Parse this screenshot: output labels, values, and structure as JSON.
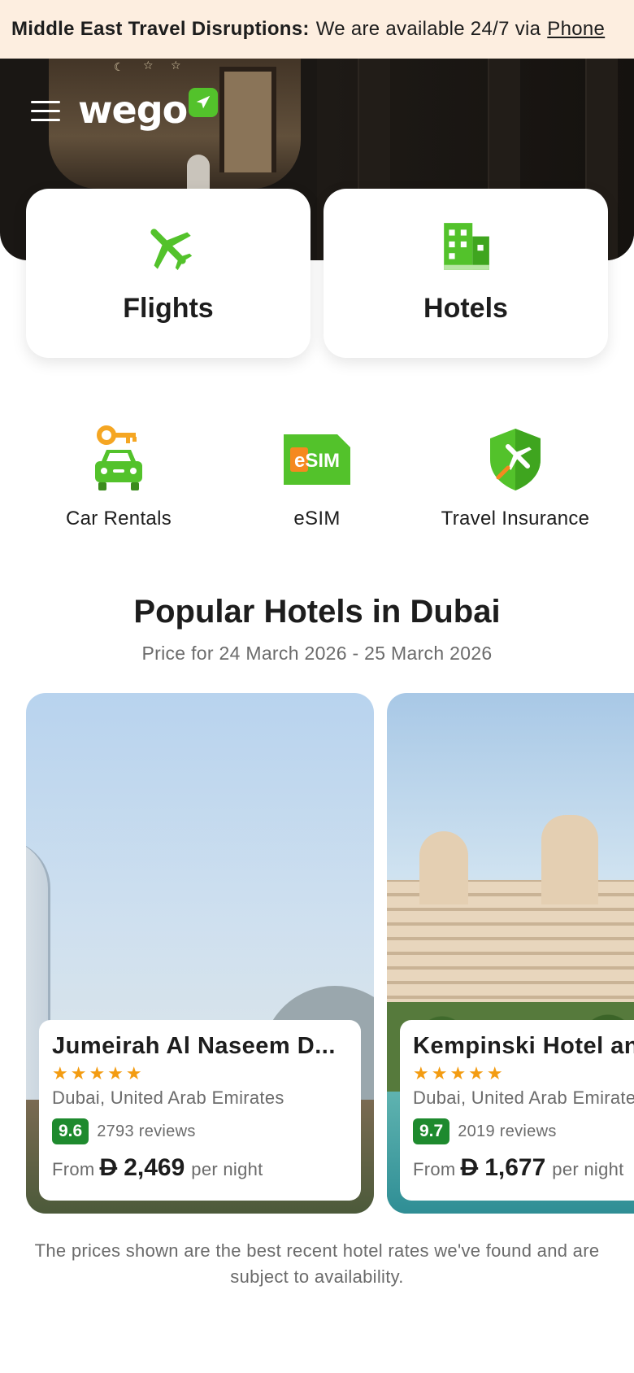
{
  "banner": {
    "title": "Middle East Travel Disruptions:",
    "text": "We are available 24/7 via",
    "link": "Phone"
  },
  "header": {
    "logo_text": "wego"
  },
  "main_services": [
    {
      "label": "Flights",
      "icon": "plane-icon"
    },
    {
      "label": "Hotels",
      "icon": "building-icon"
    }
  ],
  "services": [
    {
      "label": "Car Rentals",
      "icon": "car-key-icon"
    },
    {
      "label": "eSIM",
      "icon": "esim-icon",
      "badge": "eSIM"
    },
    {
      "label": "Travel Insurance",
      "icon": "shield-plane-icon"
    }
  ],
  "popular": {
    "title": "Popular Hotels in Dubai",
    "subtitle": "Price for 24 March 2026 - 25 March 2026"
  },
  "hotels": [
    {
      "name": "Jumeirah Al Naseem D...",
      "stars": "★★★★★",
      "location": "Dubai, United Arab Emirates",
      "score": "9.6",
      "reviews": "2793 reviews",
      "from_label": "From",
      "currency": "D",
      "price": "2,469",
      "per_label": "per night"
    },
    {
      "name": "Kempinski Hotel and",
      "stars": "★★★★★",
      "location": "Dubai, United Arab Emirates",
      "score": "9.7",
      "reviews": "2019 reviews",
      "from_label": "From",
      "currency": "D",
      "price": "1,677",
      "per_label": "per night"
    }
  ],
  "disclaimer": "The prices shown are the best recent hotel rates we've found and are subject to availability.",
  "colors": {
    "brand_green": "#53c22b",
    "banner_bg": "#fdeee0",
    "score_green": "#1e8a2e",
    "star_orange": "#f39c12",
    "insurance_orange": "#f5891f"
  }
}
